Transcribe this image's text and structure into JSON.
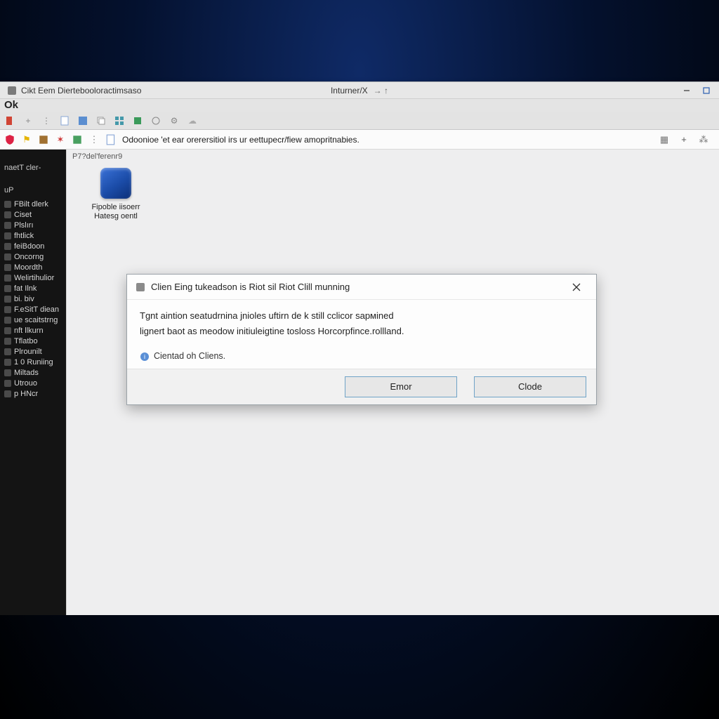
{
  "window": {
    "title_left": "Cikt Eem Diertebooloractimsaso",
    "title_ok": "Ok",
    "title_center": "Inturner/X",
    "title_center_glyphs": "→  ↑"
  },
  "tabstrip": {
    "icons": [
      "doc",
      "plus",
      "vdots",
      "page",
      "app",
      "copy",
      "grid",
      "book",
      "globe",
      "gear",
      "cloud"
    ]
  },
  "toolbar": {
    "left_icons": [
      "shield",
      "flag",
      "book",
      "puzzle",
      "note",
      "vdots",
      "page"
    ],
    "address": "Odoonioe 'et ear orerersitiol irs ur eettupecr/fiew amopritnabies.",
    "right_icons": [
      "grid",
      "plus",
      "menu"
    ]
  },
  "content": {
    "path_hint": "P7?del'ferenr9",
    "icon_label_line1": "Fipoble iisoerr",
    "icon_label_line2": "Hatesg oentl"
  },
  "sidebar": {
    "group1_label": "naetT cler-",
    "group2_label": "uP",
    "items": [
      "FBilt dlerk",
      "Ciset",
      "Plslırı",
      "fhtlick",
      "feiBdoon",
      "Oncorng",
      "Moordth",
      "Welirtihulior",
      "fat Ilnk",
      "bi. biv",
      "F.eSitT diean",
      "ue scaitstrng",
      "nft llkurn",
      "Tflatbo",
      "Plrounilt",
      "1 0 Runiing",
      "Miltads",
      "Utrouo",
      "p HNcr"
    ]
  },
  "dialog": {
    "title": "Clien Eing tukeadson is Riot sil Riot Clill munning",
    "body_line1": "Tgnt aintion seatudrnina jnioles uftirn de k still cclicor sармined",
    "body_line2": "lignert baot as meodow initiuleigtine tosloss Horcorpfince.rollland.",
    "note": "Cientad oh Cliens.",
    "btn_primary": "Emor",
    "btn_secondary": "Clode"
  }
}
